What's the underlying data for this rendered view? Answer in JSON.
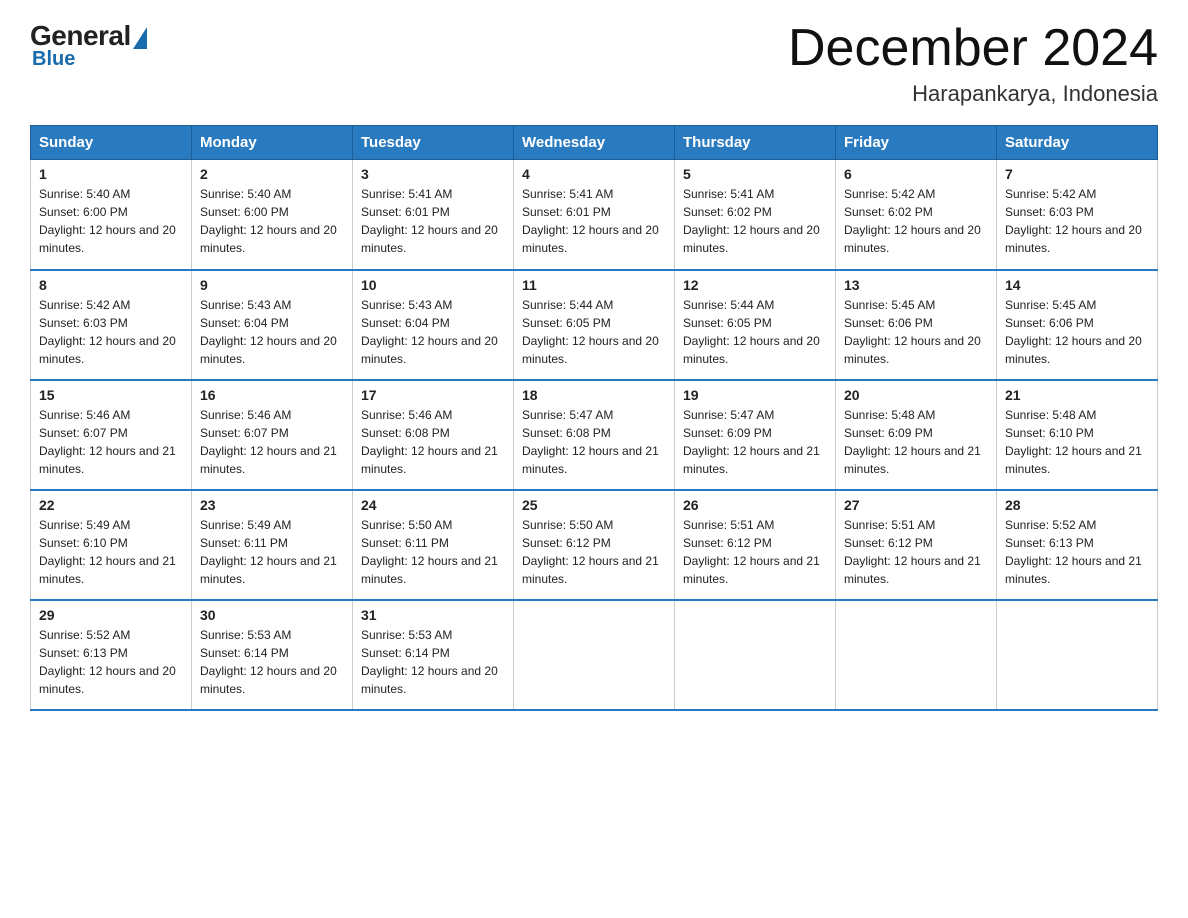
{
  "header": {
    "logo": {
      "general": "General",
      "blue": "Blue"
    },
    "title": "December 2024",
    "location": "Harapankarya, Indonesia"
  },
  "weekdays": [
    "Sunday",
    "Monday",
    "Tuesday",
    "Wednesday",
    "Thursday",
    "Friday",
    "Saturday"
  ],
  "weeks": [
    [
      {
        "day": "1",
        "sunrise": "5:40 AM",
        "sunset": "6:00 PM",
        "daylight": "12 hours and 20 minutes."
      },
      {
        "day": "2",
        "sunrise": "5:40 AM",
        "sunset": "6:00 PM",
        "daylight": "12 hours and 20 minutes."
      },
      {
        "day": "3",
        "sunrise": "5:41 AM",
        "sunset": "6:01 PM",
        "daylight": "12 hours and 20 minutes."
      },
      {
        "day": "4",
        "sunrise": "5:41 AM",
        "sunset": "6:01 PM",
        "daylight": "12 hours and 20 minutes."
      },
      {
        "day": "5",
        "sunrise": "5:41 AM",
        "sunset": "6:02 PM",
        "daylight": "12 hours and 20 minutes."
      },
      {
        "day": "6",
        "sunrise": "5:42 AM",
        "sunset": "6:02 PM",
        "daylight": "12 hours and 20 minutes."
      },
      {
        "day": "7",
        "sunrise": "5:42 AM",
        "sunset": "6:03 PM",
        "daylight": "12 hours and 20 minutes."
      }
    ],
    [
      {
        "day": "8",
        "sunrise": "5:42 AM",
        "sunset": "6:03 PM",
        "daylight": "12 hours and 20 minutes."
      },
      {
        "day": "9",
        "sunrise": "5:43 AM",
        "sunset": "6:04 PM",
        "daylight": "12 hours and 20 minutes."
      },
      {
        "day": "10",
        "sunrise": "5:43 AM",
        "sunset": "6:04 PM",
        "daylight": "12 hours and 20 minutes."
      },
      {
        "day": "11",
        "sunrise": "5:44 AM",
        "sunset": "6:05 PM",
        "daylight": "12 hours and 20 minutes."
      },
      {
        "day": "12",
        "sunrise": "5:44 AM",
        "sunset": "6:05 PM",
        "daylight": "12 hours and 20 minutes."
      },
      {
        "day": "13",
        "sunrise": "5:45 AM",
        "sunset": "6:06 PM",
        "daylight": "12 hours and 20 minutes."
      },
      {
        "day": "14",
        "sunrise": "5:45 AM",
        "sunset": "6:06 PM",
        "daylight": "12 hours and 20 minutes."
      }
    ],
    [
      {
        "day": "15",
        "sunrise": "5:46 AM",
        "sunset": "6:07 PM",
        "daylight": "12 hours and 21 minutes."
      },
      {
        "day": "16",
        "sunrise": "5:46 AM",
        "sunset": "6:07 PM",
        "daylight": "12 hours and 21 minutes."
      },
      {
        "day": "17",
        "sunrise": "5:46 AM",
        "sunset": "6:08 PM",
        "daylight": "12 hours and 21 minutes."
      },
      {
        "day": "18",
        "sunrise": "5:47 AM",
        "sunset": "6:08 PM",
        "daylight": "12 hours and 21 minutes."
      },
      {
        "day": "19",
        "sunrise": "5:47 AM",
        "sunset": "6:09 PM",
        "daylight": "12 hours and 21 minutes."
      },
      {
        "day": "20",
        "sunrise": "5:48 AM",
        "sunset": "6:09 PM",
        "daylight": "12 hours and 21 minutes."
      },
      {
        "day": "21",
        "sunrise": "5:48 AM",
        "sunset": "6:10 PM",
        "daylight": "12 hours and 21 minutes."
      }
    ],
    [
      {
        "day": "22",
        "sunrise": "5:49 AM",
        "sunset": "6:10 PM",
        "daylight": "12 hours and 21 minutes."
      },
      {
        "day": "23",
        "sunrise": "5:49 AM",
        "sunset": "6:11 PM",
        "daylight": "12 hours and 21 minutes."
      },
      {
        "day": "24",
        "sunrise": "5:50 AM",
        "sunset": "6:11 PM",
        "daylight": "12 hours and 21 minutes."
      },
      {
        "day": "25",
        "sunrise": "5:50 AM",
        "sunset": "6:12 PM",
        "daylight": "12 hours and 21 minutes."
      },
      {
        "day": "26",
        "sunrise": "5:51 AM",
        "sunset": "6:12 PM",
        "daylight": "12 hours and 21 minutes."
      },
      {
        "day": "27",
        "sunrise": "5:51 AM",
        "sunset": "6:12 PM",
        "daylight": "12 hours and 21 minutes."
      },
      {
        "day": "28",
        "sunrise": "5:52 AM",
        "sunset": "6:13 PM",
        "daylight": "12 hours and 21 minutes."
      }
    ],
    [
      {
        "day": "29",
        "sunrise": "5:52 AM",
        "sunset": "6:13 PM",
        "daylight": "12 hours and 20 minutes."
      },
      {
        "day": "30",
        "sunrise": "5:53 AM",
        "sunset": "6:14 PM",
        "daylight": "12 hours and 20 minutes."
      },
      {
        "day": "31",
        "sunrise": "5:53 AM",
        "sunset": "6:14 PM",
        "daylight": "12 hours and 20 minutes."
      },
      null,
      null,
      null,
      null
    ]
  ]
}
